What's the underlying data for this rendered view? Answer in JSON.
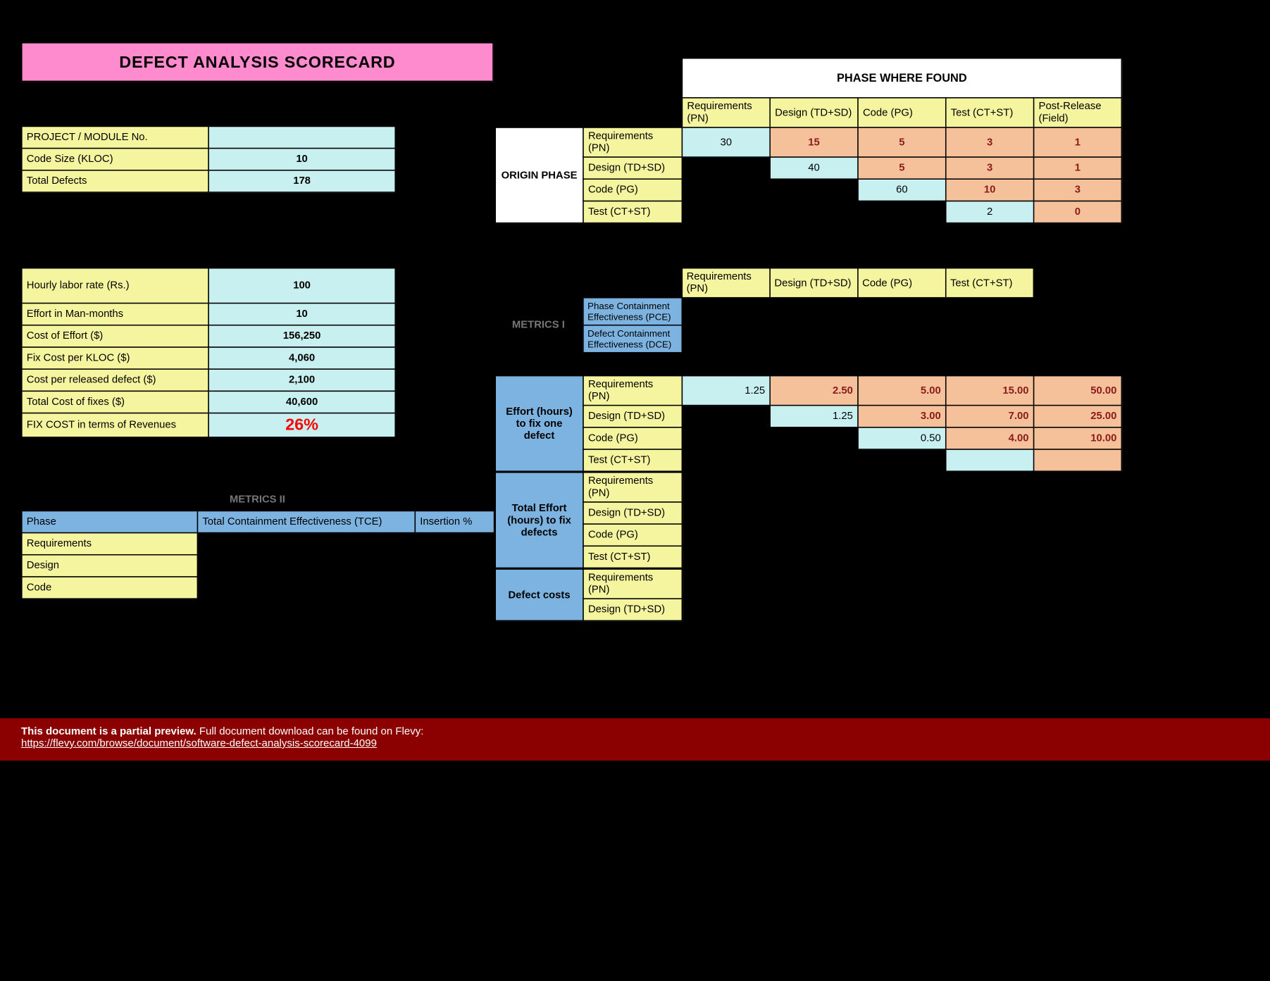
{
  "title": "DEFECT ANALYSIS SCORECARD",
  "project": {
    "labels": {
      "module": "PROJECT / MODULE No.",
      "size": "Code Size (KLOC)",
      "defects": "Total Defects"
    },
    "values": {
      "module": "",
      "size": "10",
      "defects": "178"
    }
  },
  "cost": {
    "labels": {
      "rate": "Hourly labor rate (Rs.)",
      "effort": "Effort in Man-months",
      "costEffort": "Cost of Effort ($)",
      "fixKloc": "Fix Cost per KLOC ($)",
      "costDefect": "Cost per released defect ($)",
      "totalFix": "Total Cost of fixes ($)",
      "fixRev": "FIX COST in terms of Revenues"
    },
    "values": {
      "rate": "100",
      "effort": "10",
      "costEffort": "156,250",
      "fixKloc": "4,060",
      "costDefect": "2,100",
      "totalFix": "40,600",
      "fixRev": "26%"
    }
  },
  "phaseFound": {
    "title": "PHASE WHERE FOUND",
    "origin": "ORIGIN PHASE",
    "cols": [
      "Requirements (PN)",
      "Design (TD+SD)",
      "Code (PG)",
      "Test (CT+ST)",
      "Post-Release (Field)"
    ],
    "rows": [
      "Requirements (PN)",
      "Design (TD+SD)",
      "Code (PG)",
      "Test (CT+ST)"
    ],
    "grid": [
      [
        "30",
        "15",
        "5",
        "3",
        "1"
      ],
      [
        "",
        "40",
        "5",
        "3",
        "1"
      ],
      [
        "",
        "",
        "60",
        "10",
        "3"
      ],
      [
        "",
        "",
        "",
        "2",
        "0"
      ]
    ]
  },
  "metrics1": {
    "label": "METRICS I",
    "cols": [
      "Requirements (PN)",
      "Design (TD+SD)",
      "Code (PG)",
      "Test (CT+ST)"
    ],
    "rows": [
      "Phase Containment Effectiveness (PCE)",
      "Defect Containment Effectiveness (DCE)"
    ]
  },
  "effortFix": {
    "label": "Effort (hours) to fix one defect",
    "rows": [
      "Requirements (PN)",
      "Design (TD+SD)",
      "Code (PG)",
      "Test (CT+ST)"
    ],
    "grid": [
      [
        "1.25",
        "2.50",
        "5.00",
        "15.00",
        "50.00"
      ],
      [
        "",
        "1.25",
        "3.00",
        "7.00",
        "25.00"
      ],
      [
        "",
        "",
        "0.50",
        "4.00",
        "10.00"
      ],
      [
        "",
        "",
        "",
        "",
        ""
      ]
    ]
  },
  "totalEffort": {
    "label": "Total Effort (hours) to fix defects",
    "rows": [
      "Requirements (PN)",
      "Design (TD+SD)",
      "Code (PG)",
      "Test (CT+ST)"
    ]
  },
  "defectCosts": {
    "label": "Defect costs",
    "rows": [
      "Requirements (PN)",
      "Design (TD+SD)"
    ]
  },
  "metrics2": {
    "label": "METRICS II",
    "headers": [
      "Phase",
      "Total Containment Effectiveness (TCE)",
      "Insertion %"
    ],
    "rows": [
      "Requirements",
      "Design",
      "Code"
    ]
  },
  "banner": {
    "bold": "This document is a partial preview.",
    "rest": " Full document download can be found on Flevy:",
    "url": "https://flevy.com/browse/document/software-defect-analysis-scorecard-4099"
  }
}
